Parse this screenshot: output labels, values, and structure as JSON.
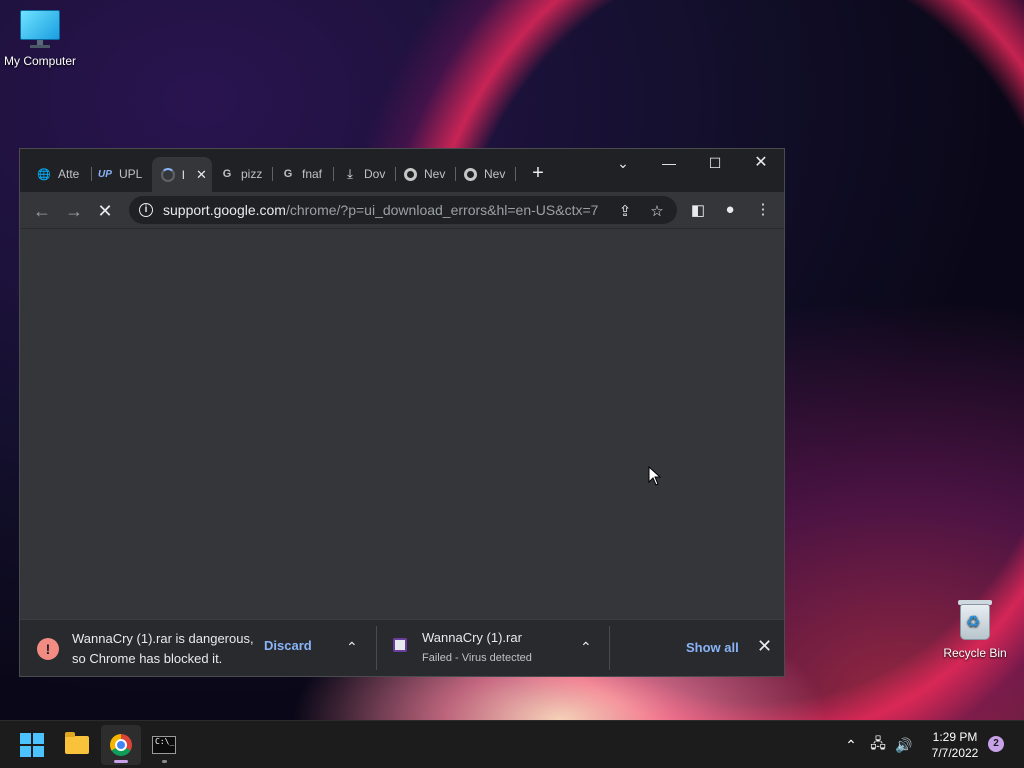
{
  "desktop": {
    "icons": [
      {
        "label": "My Computer",
        "icon": "monitor-icon"
      },
      {
        "label": "Recycle Bin",
        "icon": "recycle-bin-icon"
      }
    ]
  },
  "browser": {
    "tabs": [
      {
        "label": "Atte",
        "icon": "globe-icon"
      },
      {
        "label": "UPL",
        "icon": "up-logo-icon"
      },
      {
        "label": "l",
        "icon": "loading-spinner-icon",
        "active": true
      },
      {
        "label": "pizz",
        "icon": "google-icon"
      },
      {
        "label": "fnaf",
        "icon": "google-icon"
      },
      {
        "label": "Dov",
        "icon": "download-icon"
      },
      {
        "label": "Nev",
        "icon": "chrome-icon"
      },
      {
        "label": "Nev",
        "icon": "chrome-icon"
      }
    ],
    "address": {
      "host": "support.google.com",
      "path": "/chrome/?p=ui_download_errors&hl=en-US&ctx=7"
    },
    "download_shelf": {
      "item1": {
        "line1": "WannaCry (1).rar is dangerous,",
        "line2": "so Chrome has blocked it.",
        "action": "Discard"
      },
      "item2": {
        "name": "WannaCry (1).rar",
        "status": "Failed - Virus detected"
      },
      "show_all": "Show all"
    }
  },
  "taskbar": {
    "clock_time": "1:29 PM",
    "clock_date": "7/7/2022",
    "notification_count": "2"
  },
  "colors": {
    "accent": "#8ab4f8",
    "danger": "#f28b82",
    "window_bg": "#35363a",
    "titlebar_bg": "#202124"
  }
}
